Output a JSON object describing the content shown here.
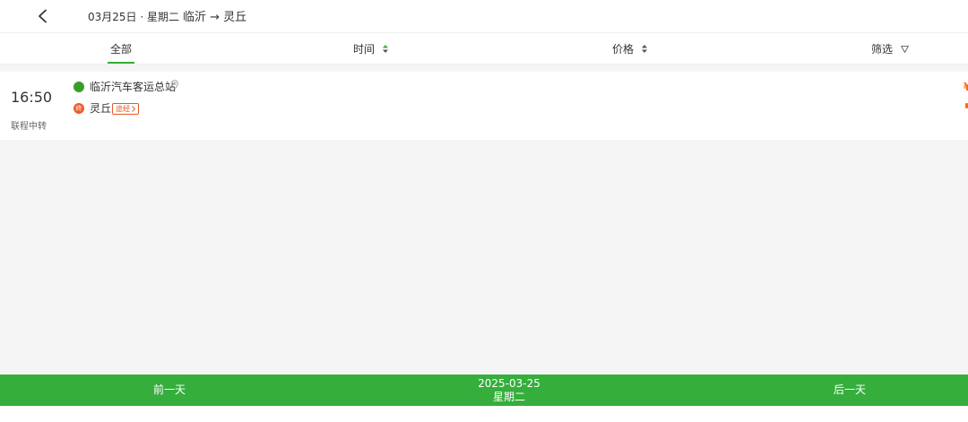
{
  "header": {
    "date_text": "03月25日 · 星期二",
    "route_text": "临沂 → 灵丘"
  },
  "tabs": [
    {
      "label": "全部",
      "active": true
    },
    {
      "label": "时间"
    },
    {
      "label": "价格"
    },
    {
      "label": "筛选"
    }
  ],
  "trip": {
    "departure_time": "16:50",
    "type": "联程中转",
    "from_station": "临沂汽车客运总站",
    "to_marker": "终",
    "to_station": "灵丘",
    "via_label": "途经",
    "price_symbol": "¥"
  },
  "footer": {
    "prev_label": "前一天",
    "date": "2025-03-25",
    "weekday": "星期二",
    "next_label": "后一天"
  },
  "icons": [
    "back-arrow-icon",
    "sort-icon",
    "filter-icon",
    "location-pin-icon",
    "chevron-right-icon"
  ],
  "colors": {
    "accent": "#35ae3c",
    "origin_dot": "#3a9d2b",
    "destination_dot": "#f05a28",
    "price": "#ff6a00",
    "background": "#f5f5f5"
  }
}
